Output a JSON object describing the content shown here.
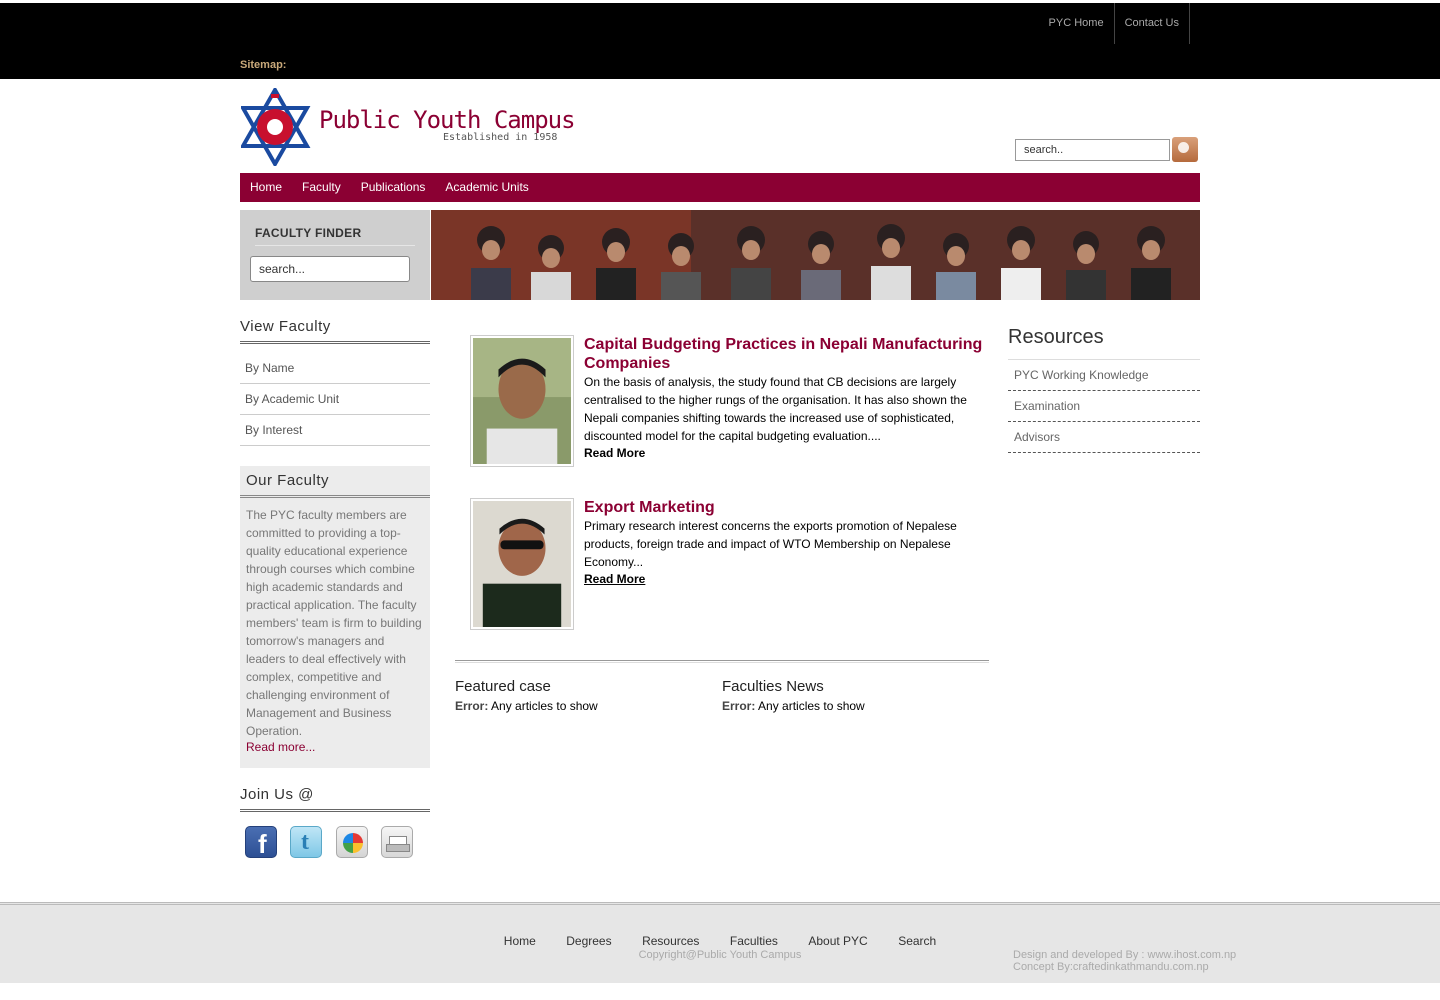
{
  "topnav": {
    "items": [
      "PYC Home",
      "Contact Us"
    ]
  },
  "sitemap_label": "Sitemap:",
  "logo": {
    "name": "Public Youth Campus",
    "tagline": "Established in 1958"
  },
  "search": {
    "placeholder": "search.."
  },
  "mainnav": {
    "items": [
      "Home",
      "Faculty",
      "Publications",
      "Academic Units"
    ]
  },
  "faculty_finder": {
    "title": "FACULTY FINDER",
    "placeholder": "search..."
  },
  "view_faculty": {
    "title": "View Faculty",
    "items": [
      "By Name",
      "By Academic Unit",
      "By Interest"
    ]
  },
  "our_faculty": {
    "title": "Our Faculty",
    "text": "The PYC faculty members are committed to providing a top-quality educational experience through courses which combine high academic standards and practical application. The faculty members' team is firm to building tomorrow's managers and leaders to deal effectively with complex, competitive and challenging environment of Management and Business Operation.",
    "more": "Read more..."
  },
  "join_us": {
    "title": "Join Us @",
    "icons": [
      "facebook-icon",
      "twitter-icon",
      "google-buzz-icon",
      "print-icon"
    ]
  },
  "articles": [
    {
      "title": "Capital Budgeting Practices in Nepali Manufacturing Companies",
      "body": "On the basis of analysis, the study found that CB decisions are largely centralised to the higher rungs of the organisation. It has also shown the Nepali companies shifting towards the increased use of sophisticated, discounted model for the capital budgeting evaluation....",
      "more": "Read More"
    },
    {
      "title": "Export Marketing",
      "body": "Primary research interest concerns the exports promotion of Nepalese products, foreign trade and impact of WTO Membership on Nepalese Economy...",
      "more": "Read More"
    }
  ],
  "featured_case": {
    "title": "Featured case",
    "error_label": "Error:",
    "error_text": " Any articles to show"
  },
  "faculties_news": {
    "title": "Faculties News",
    "error_label": "Error:",
    "error_text": " Any articles to show"
  },
  "resources": {
    "title": "Resources",
    "items": [
      "PYC Working Knowledge",
      "Examination",
      "Advisors"
    ]
  },
  "footer": {
    "nav": [
      "Home",
      "Degrees",
      "Resources",
      "Faculties",
      "About PYC",
      "Search"
    ],
    "copyright": "Copyright@Public Youth Campus",
    "credit_dev": "Design and developed By : www.ihost.com.np",
    "credit_concept": "Concept By:craftedinkathmandu.com.np"
  },
  "colors": {
    "brand": "#8b0033",
    "topbar": "#000000",
    "accent_search": "#c47f52"
  }
}
